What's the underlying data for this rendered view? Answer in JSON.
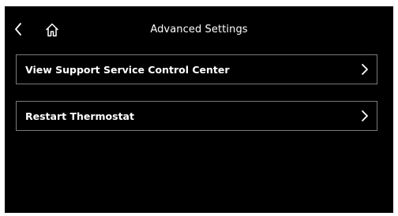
{
  "header": {
    "title": "Advanced Settings",
    "back_icon": "chevron-left-icon",
    "home_icon": "home-icon"
  },
  "menu": {
    "items": [
      {
        "label": "View Support Service Control Center",
        "icon": "chevron-right-icon"
      },
      {
        "label": "Restart Thermostat",
        "icon": "chevron-right-icon"
      }
    ]
  },
  "colors": {
    "background": "#000000",
    "text": "#ffffff",
    "border": "#7a7a7a"
  }
}
